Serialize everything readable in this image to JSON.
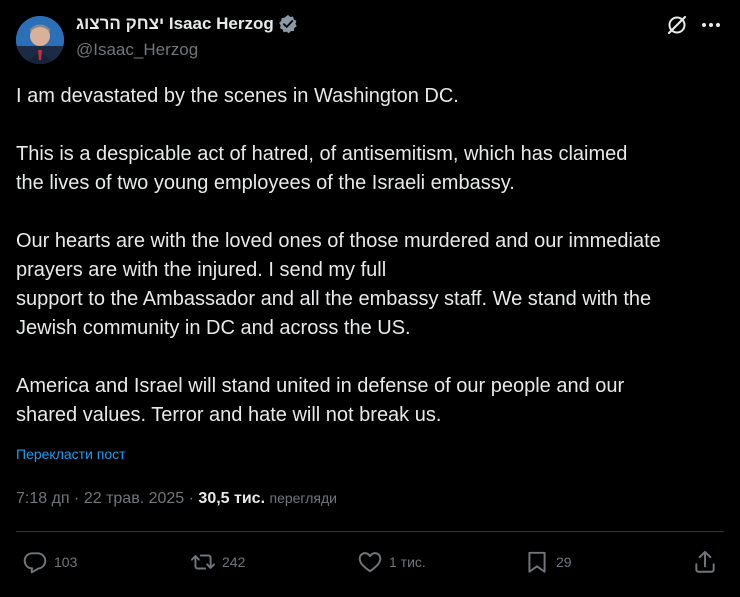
{
  "author": {
    "display_name": "יצחק הרצוג Isaac Herzog",
    "handle": "@Isaac_Herzog"
  },
  "icons": {
    "verified": "verified-badge-icon",
    "grok": "grok-icon",
    "more": "more-icon",
    "reply": "reply-icon",
    "repost": "repost-icon",
    "like": "like-icon",
    "bookmark": "bookmark-icon",
    "share": "share-icon"
  },
  "colors": {
    "background": "#000000",
    "text": "#e7e9ea",
    "muted": "#71767b",
    "link": "#1d9bf0"
  },
  "tweet": {
    "paragraphs": [
      [
        "I am devastated by the scenes in Washington DC."
      ],
      [
        "This is a despicable act of hatred, of antisemitism, which has claimed",
        "the lives of two young employees of the Israeli embassy."
      ],
      [
        "Our hearts are with the loved ones of those murdered and our immediate",
        "prayers are with the injured. I send my full",
        "support to the Ambassador and all the embassy staff. We stand with the",
        "Jewish community in DC and across the US."
      ],
      [
        "America and Israel will stand united in defense of our people and our",
        "shared values. Terror and hate will not break us."
      ]
    ],
    "translate_label": "Перекласти пост",
    "time": "7:18 дп",
    "separator": "·",
    "date": "22 трав. 2025",
    "views_count": "30,5 тис.",
    "views_label": "перегляди"
  },
  "actions": {
    "reply_count": "103",
    "repost_count": "242",
    "like_count": "1 тис.",
    "bookmark_count": "29"
  }
}
